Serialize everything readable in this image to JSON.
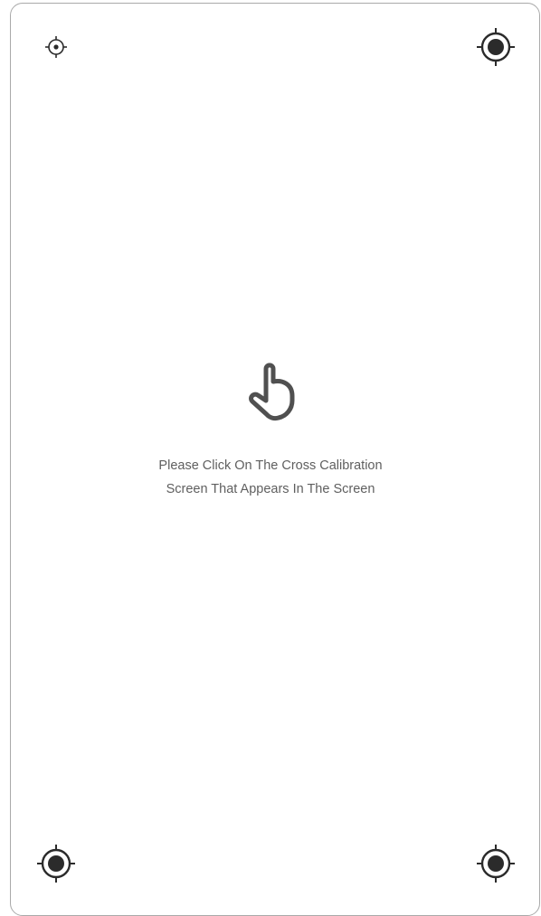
{
  "instructions": {
    "line1": "Please Click On The Cross Calibration",
    "line2": "Screen That Appears In The Screen"
  },
  "icons": {
    "target": "crosshair-target-icon",
    "pointer": "hand-pointer-icon"
  },
  "colors": {
    "target": "#2b2b2b",
    "hand": "#505050",
    "text": "#5f5f5f",
    "border": "#a9a9a9"
  }
}
